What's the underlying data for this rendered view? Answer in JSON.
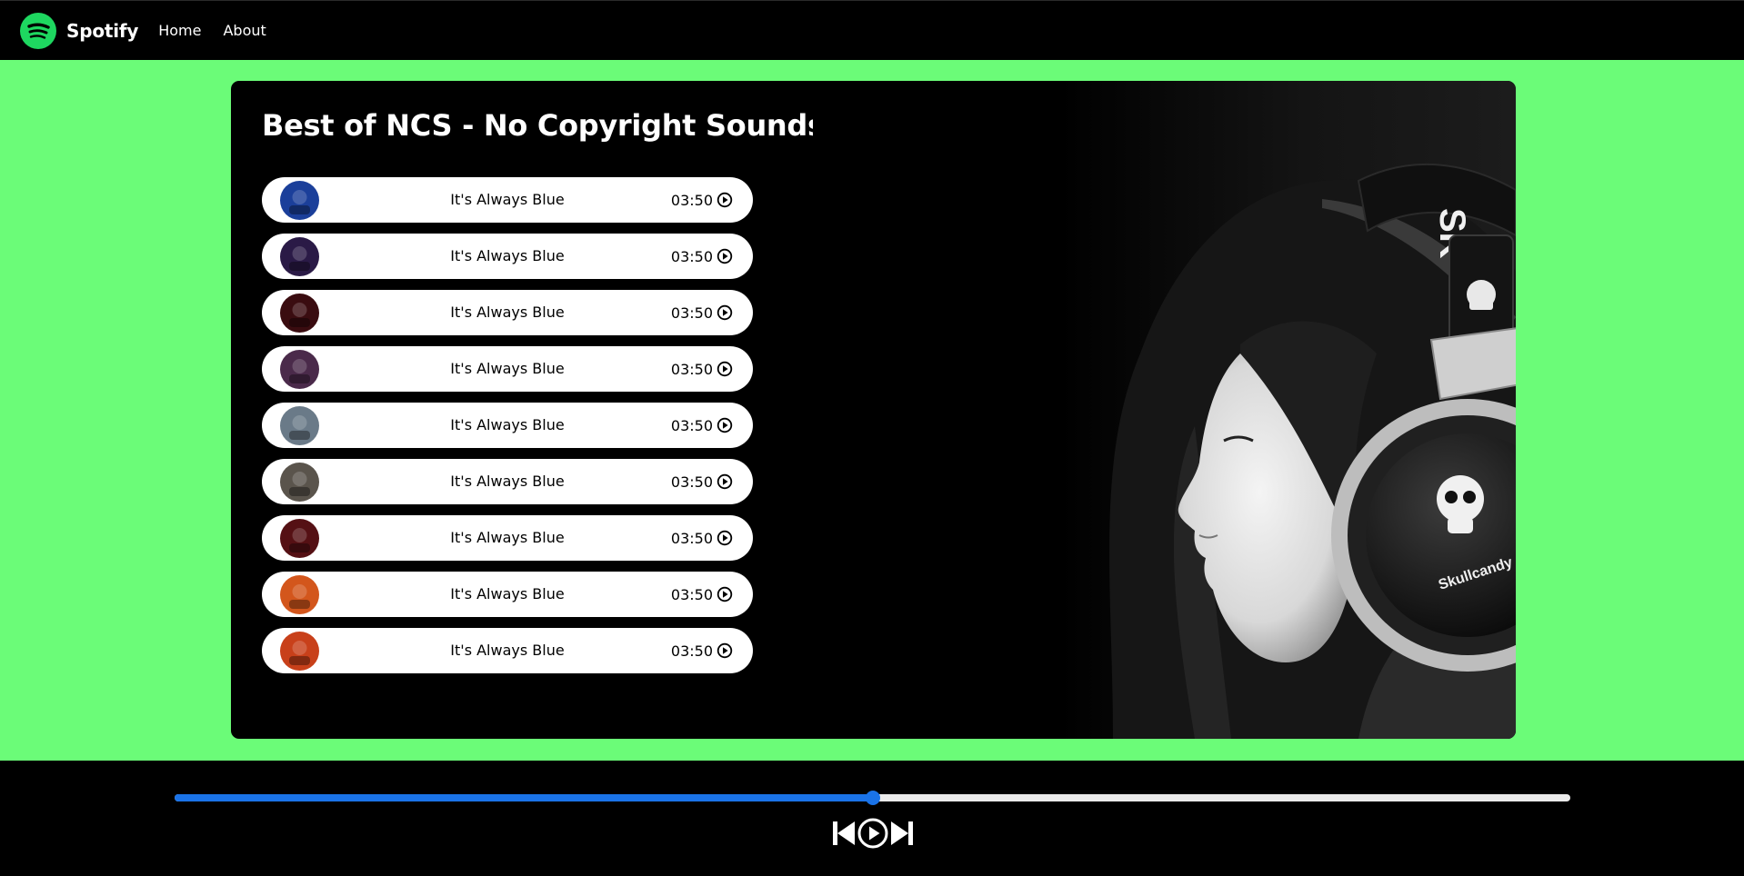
{
  "navbar": {
    "brand": "Spotify",
    "links": [
      "Home",
      "About"
    ]
  },
  "playlist": {
    "title": "Best of NCS - No Copyright Sounds",
    "songs": [
      {
        "name": "It's Always Blue",
        "duration": "03:50",
        "cover_color": "#1b3f9a"
      },
      {
        "name": "It's Always Blue",
        "duration": "03:50",
        "cover_color": "#2a1a46"
      },
      {
        "name": "It's Always Blue",
        "duration": "03:50",
        "cover_color": "#3a0c10"
      },
      {
        "name": "It's Always Blue",
        "duration": "03:50",
        "cover_color": "#4a2a4a"
      },
      {
        "name": "It's Always Blue",
        "duration": "03:50",
        "cover_color": "#6a7a88"
      },
      {
        "name": "It's Always Blue",
        "duration": "03:50",
        "cover_color": "#5a544c"
      },
      {
        "name": "It's Always Blue",
        "duration": "03:50",
        "cover_color": "#551014"
      },
      {
        "name": "It's Always Blue",
        "duration": "03:50",
        "cover_color": "#d3561c"
      },
      {
        "name": "It's Always Blue",
        "duration": "03:50",
        "cover_color": "#c8401a"
      }
    ]
  },
  "hero": {
    "brand_text": "Skullcandy",
    "band_text": "SK"
  },
  "player": {
    "progress_fraction": 0.5,
    "controls": [
      "previous-icon",
      "play-icon",
      "next-icon"
    ]
  },
  "colors": {
    "page_background": "#6bfc78",
    "brand_green": "#1ed760",
    "progress_accent": "#1a73e8",
    "song_row_background": "#ffffff"
  }
}
